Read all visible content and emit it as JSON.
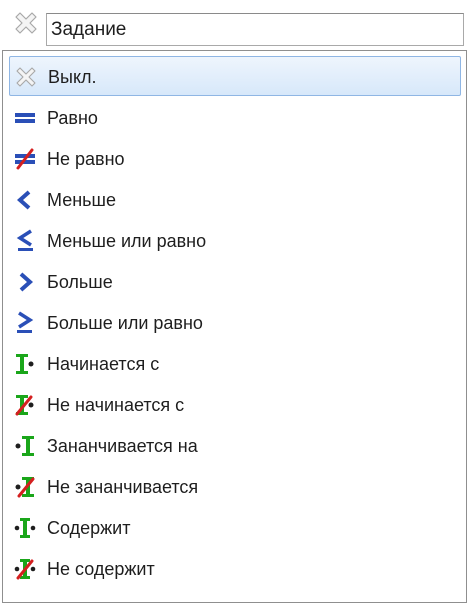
{
  "filter": {
    "value": "Задание",
    "icon": "clear-filter-icon"
  },
  "dropdown": {
    "selected_index": 0,
    "items": [
      {
        "label": "Выкл.",
        "icon": "off-icon"
      },
      {
        "label": "Равно",
        "icon": "equals-icon"
      },
      {
        "label": "Не равно",
        "icon": "not-equals-icon"
      },
      {
        "label": "Меньше",
        "icon": "less-than-icon"
      },
      {
        "label": "Меньше или равно",
        "icon": "less-or-equal-icon"
      },
      {
        "label": "Больше",
        "icon": "greater-than-icon"
      },
      {
        "label": "Больше или равно",
        "icon": "greater-or-equal-icon"
      },
      {
        "label": "Начинается с",
        "icon": "starts-with-icon"
      },
      {
        "label": "Не начинается с",
        "icon": "not-starts-with-icon"
      },
      {
        "label": "Зананчивается на",
        "icon": "ends-with-icon"
      },
      {
        "label": "Не зананчивается",
        "icon": "not-ends-with-icon"
      },
      {
        "label": "Содержит",
        "icon": "contains-icon"
      },
      {
        "label": "Не содержит",
        "icon": "not-contains-icon"
      }
    ]
  },
  "colors": {
    "blue": "#2a4fb7",
    "green": "#1aa61a",
    "red": "#d42020",
    "selection_border": "#8fb6e4"
  }
}
